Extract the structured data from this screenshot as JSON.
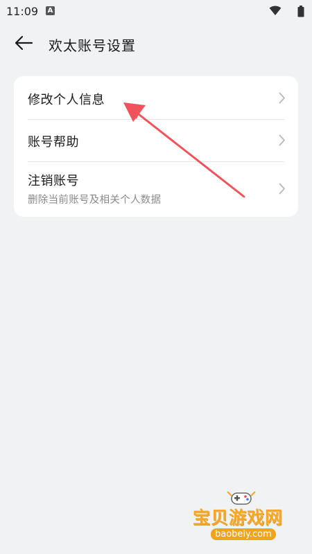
{
  "status_bar": {
    "time": "11:09",
    "notification_icon": "a-icon",
    "wifi_icon": "wifi-icon",
    "battery_icon": "battery-icon"
  },
  "header": {
    "back_icon": "back-arrow-icon",
    "title": "欢太账号设置"
  },
  "settings": {
    "items": [
      {
        "label": "修改个人信息",
        "sub": ""
      },
      {
        "label": "账号帮助",
        "sub": ""
      },
      {
        "label": "注销账号",
        "sub": "删除当前账号及相关个人数据"
      }
    ]
  },
  "annotation": {
    "color": "#f0545a"
  },
  "watermark": {
    "title": "宝贝游戏网",
    "domain": "baobeiy.com",
    "icon": "gamepad-icon"
  },
  "colors": {
    "background": "#f1f2f4",
    "card": "#ffffff",
    "text_primary": "#1a1a1a",
    "text_secondary": "#8a8a8a",
    "chevron": "#b8b8b8"
  }
}
